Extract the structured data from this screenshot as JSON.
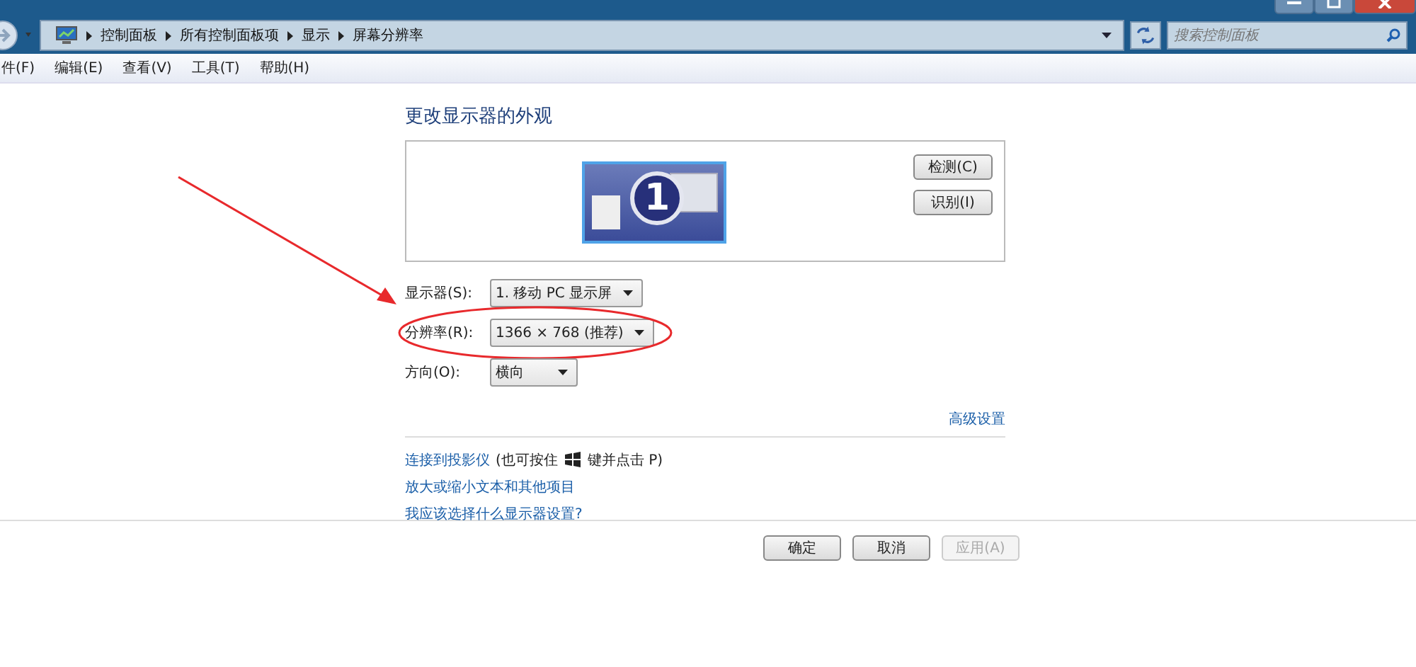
{
  "address_bar": {
    "crumbs": [
      "控制面板",
      "所有控制面板项",
      "显示",
      "屏幕分辨率"
    ]
  },
  "search": {
    "placeholder": "搜索控制面板"
  },
  "menu": [
    "件(F)",
    "编辑(E)",
    "查看(V)",
    "工具(T)",
    "帮助(H)"
  ],
  "heading": "更改显示器的外观",
  "monitor": {
    "number": "1"
  },
  "side_buttons": [
    "检测(C)",
    "识别(I)"
  ],
  "settings": [
    {
      "label": "显示器(S):",
      "value": "1. 移动 PC 显示屏",
      "highlighted": false
    },
    {
      "label": "分辨率(R):",
      "value": "1366 × 768 (推荐)",
      "highlighted": true
    },
    {
      "label": "方向(O):",
      "value": "横向",
      "highlighted": false
    }
  ],
  "advanced_link": "高级设置",
  "projector": {
    "link": "连接到投影仪",
    "note_before": "(也可按住",
    "note_after": "键并点击 P)"
  },
  "links": [
    "放大或缩小文本和其他项目",
    "我应该选择什么显示器设置?"
  ],
  "buttons": [
    {
      "label": "确定",
      "disabled": false
    },
    {
      "label": "取消",
      "disabled": false
    },
    {
      "label": "应用(A)",
      "disabled": true
    }
  ]
}
